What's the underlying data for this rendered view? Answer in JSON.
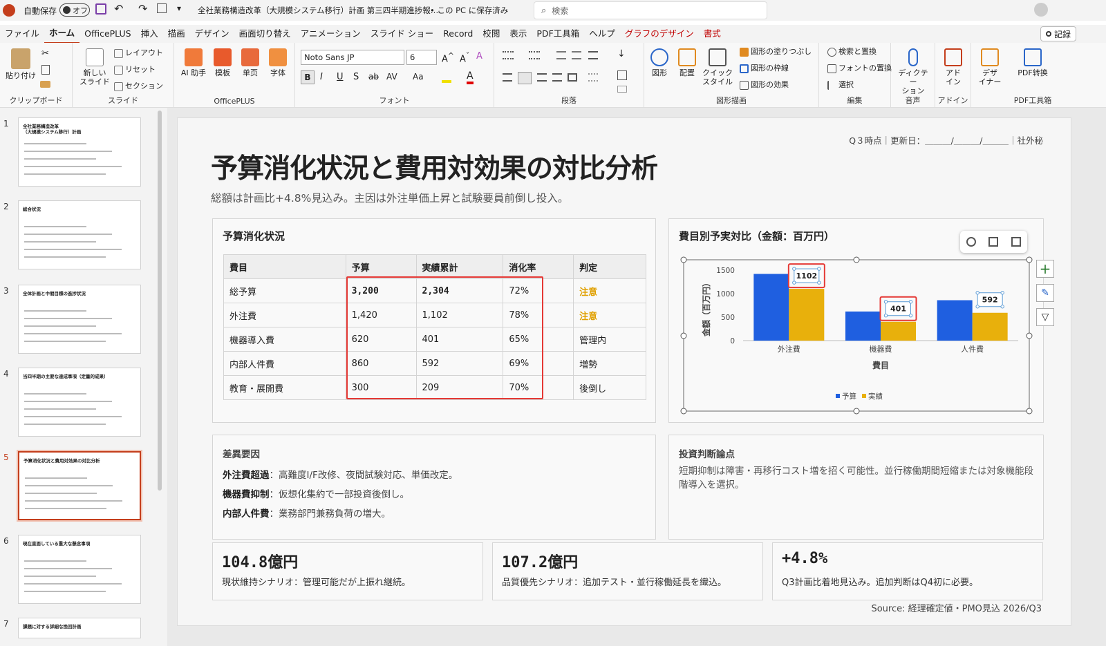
{
  "titlebar": {
    "autosave_label": "自動保存",
    "autosave_state": "オフ",
    "doc_title": "全社業務構造改革（大規模システム移行）計画 第三四半期進捗報…",
    "save_state": "• この PC に保存済み",
    "search_placeholder": "検索"
  },
  "ribbon_tabs": [
    "ファイル",
    "ホーム",
    "OfficePLUS",
    "挿入",
    "描画",
    "デザイン",
    "画面切り替え",
    "アニメーション",
    "スライド ショー",
    "Record",
    "校閲",
    "表示",
    "PDF工具箱",
    "ヘルプ",
    "グラフのデザイン",
    "書式"
  ],
  "record_button": "記録",
  "ribbon": {
    "clipboard": {
      "paste": "貼り付け",
      "label": "クリップボード"
    },
    "slides": {
      "new_slide": "新しい\nスライド",
      "layout": "レイアウト",
      "reset": "リセット",
      "section": "セクション",
      "label": "スライド"
    },
    "officeplus": {
      "ai": "AI 助手",
      "template": "模板",
      "single": "单页",
      "font": "字体",
      "label": "OfficePLUS"
    },
    "font": {
      "font_name": "Noto Sans JP",
      "font_size": "6",
      "bold": "B",
      "italic": "I",
      "underline": "U",
      "shadow": "S",
      "strike": "ab",
      "spacing": "AV",
      "case": "Aa",
      "label": "フォント"
    },
    "paragraph": {
      "label": "段落"
    },
    "drawing": {
      "shapes": "図形",
      "arrange": "配置",
      "quick": "クイック\nスタイル",
      "fill": "図形の塗りつぶし",
      "outline": "図形の枠線",
      "effect": "図形の効果",
      "label": "図形描画"
    },
    "editing": {
      "find": "検索と置換",
      "replace": "フォントの置換",
      "select": "選択",
      "label": "編集"
    },
    "voice": {
      "dictate": "ディクテー\nション",
      "label": "音声"
    },
    "addin": {
      "addin": "アド\nイン",
      "label": "アドイン"
    },
    "designer": {
      "designer": "デザ\nイナー"
    },
    "pdf": {
      "convert": "PDF转换",
      "label": "PDF工具箱"
    }
  },
  "thumbnails": [
    {
      "num": "1",
      "title": "全社業務構造改革\n（大規模システム移行）計画"
    },
    {
      "num": "2",
      "title": "総合状況"
    },
    {
      "num": "3",
      "title": "全体計画と中間目標の進捗状況"
    },
    {
      "num": "4",
      "title": "当四半期の主要な達成事項（定量的成果）"
    },
    {
      "num": "5",
      "title": "予算消化状況と費用対効果の対比分析"
    },
    {
      "num": "6",
      "title": "現在直面している重大な懸念事項"
    },
    {
      "num": "7",
      "title": "課題に対する詳細な挽回計画"
    }
  ],
  "slide": {
    "meta": "Q３時点｜更新日：＿＿＿/＿＿＿/＿＿＿｜社外秘",
    "title": "予算消化状況と費用対効果の対比分析",
    "subtitle": "総額は計画比+4.8%見込み。主因は外注単価上昇と試験要員前倒し投入。",
    "budget_card": {
      "title": "予算消化状況",
      "headers": [
        "費目",
        "予算",
        "実績累計",
        "消化率",
        "判定"
      ],
      "rows": [
        [
          "総予算",
          "3,200",
          "2,304",
          "72%",
          "注意"
        ],
        [
          "外注費",
          "1,420",
          "1,102",
          "78%",
          "注意"
        ],
        [
          "機器導入費",
          "620",
          "401",
          "65%",
          "管理内"
        ],
        [
          "内部人件費",
          "860",
          "592",
          "69%",
          "増勢"
        ],
        [
          "教育・展開費",
          "300",
          "209",
          "70%",
          "後倒し"
        ]
      ]
    },
    "chart_card": {
      "title": "費目別予実対比（金額：百万円）"
    },
    "variance": {
      "title": "差異要因",
      "items": [
        {
          "label": "外注費超過",
          "text": "：高難度I/F改修、夜間試験対応、単価改定。"
        },
        {
          "label": "機器費抑制",
          "text": "：仮想化集約で一部投資後倒し。"
        },
        {
          "label": "内部人件費",
          "text": "：業務部門兼務負荷の増大。"
        }
      ]
    },
    "investment": {
      "title": "投資判断論点",
      "text": "短期抑制は障害・再移行コスト増を招く可能性。並行稼働期間短縮または対象機能段階導入を選択。"
    },
    "kpis": [
      {
        "value": "104.8億円",
        "text": "現状維持シナリオ：管理可能だが上振れ継続。"
      },
      {
        "value": "107.2億円",
        "text": "品質優先シナリオ：追加テスト・並行稼働延長を織込。"
      },
      {
        "value": "+4.8%",
        "text": "Q3計画比着地見込み。追加判断はQ4初に必要。"
      }
    ],
    "source": "Source: 経理確定値・PMO見込 2026/Q3"
  },
  "chart_data": {
    "type": "bar",
    "categories": [
      "外注費",
      "機器費",
      "人件費"
    ],
    "series": [
      {
        "name": "予算",
        "values": [
          1420,
          620,
          860
        ],
        "color": "#1f5fe0"
      },
      {
        "name": "実績",
        "values": [
          1102,
          401,
          592
        ],
        "color": "#e8b00c"
      }
    ],
    "data_labels": [
      "1102",
      "401",
      "592"
    ],
    "xlabel": "費目",
    "ylabel": "金額（百万円）",
    "ylim": [
      0,
      1500
    ],
    "yticks": [
      "0",
      "500",
      "1000",
      "1500"
    ],
    "legend": "bottom"
  }
}
